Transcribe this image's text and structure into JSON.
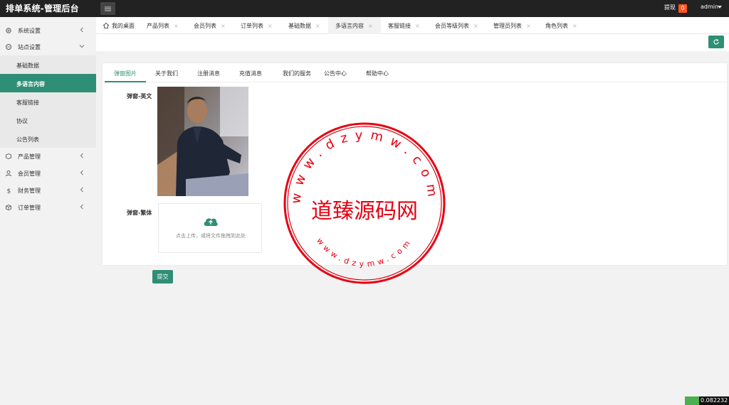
{
  "header": {
    "title": "排单系统-管理后台",
    "withdraw_label": "提现",
    "withdraw_count": "0",
    "user": "admin"
  },
  "sidebar": {
    "items": [
      {
        "label": "系统设置",
        "icon": "gear-icon"
      },
      {
        "label": "站点设置",
        "icon": "site-icon"
      },
      {
        "label": "产品管理",
        "icon": "box-icon"
      },
      {
        "label": "会员管理",
        "icon": "user-icon"
      },
      {
        "label": "财务管理",
        "icon": "dollar-icon"
      },
      {
        "label": "订单管理",
        "icon": "order-icon"
      }
    ],
    "sub_items": [
      {
        "label": "基础数据"
      },
      {
        "label": "多语言内容"
      },
      {
        "label": "客服链接"
      },
      {
        "label": "协议"
      },
      {
        "label": "公告列表"
      }
    ]
  },
  "tabs": [
    {
      "label": "我的桌面"
    },
    {
      "label": "产品列表"
    },
    {
      "label": "会员列表"
    },
    {
      "label": "订单列表"
    },
    {
      "label": "基础数据"
    },
    {
      "label": "多语言内容"
    },
    {
      "label": "客服链接"
    },
    {
      "label": "会员等级列表"
    },
    {
      "label": "管理员列表"
    },
    {
      "label": "角色列表"
    }
  ],
  "tab_close": "×",
  "content": {
    "tabs": [
      {
        "label": "弹窗图片"
      },
      {
        "label": "关于我们"
      },
      {
        "label": "注册消息"
      },
      {
        "label": "充值消息"
      },
      {
        "label": "我们的服务"
      },
      {
        "label": "公告中心"
      },
      {
        "label": "帮助中心"
      }
    ],
    "field_en": "弹窗-英文",
    "field_tw": "弹窗-繁体",
    "upload_hint": "点击上传，或将文件拖拽到此处",
    "submit": "提交"
  },
  "watermark": {
    "top_text": "www.dzymw.com",
    "center_text": "道臻源码网",
    "bottom_text": "www.dzymw.com"
  },
  "footer_value": "0.082232",
  "colors": {
    "accent": "#2f8f76",
    "badge": "#ff5722",
    "stamp": "#e60012"
  }
}
